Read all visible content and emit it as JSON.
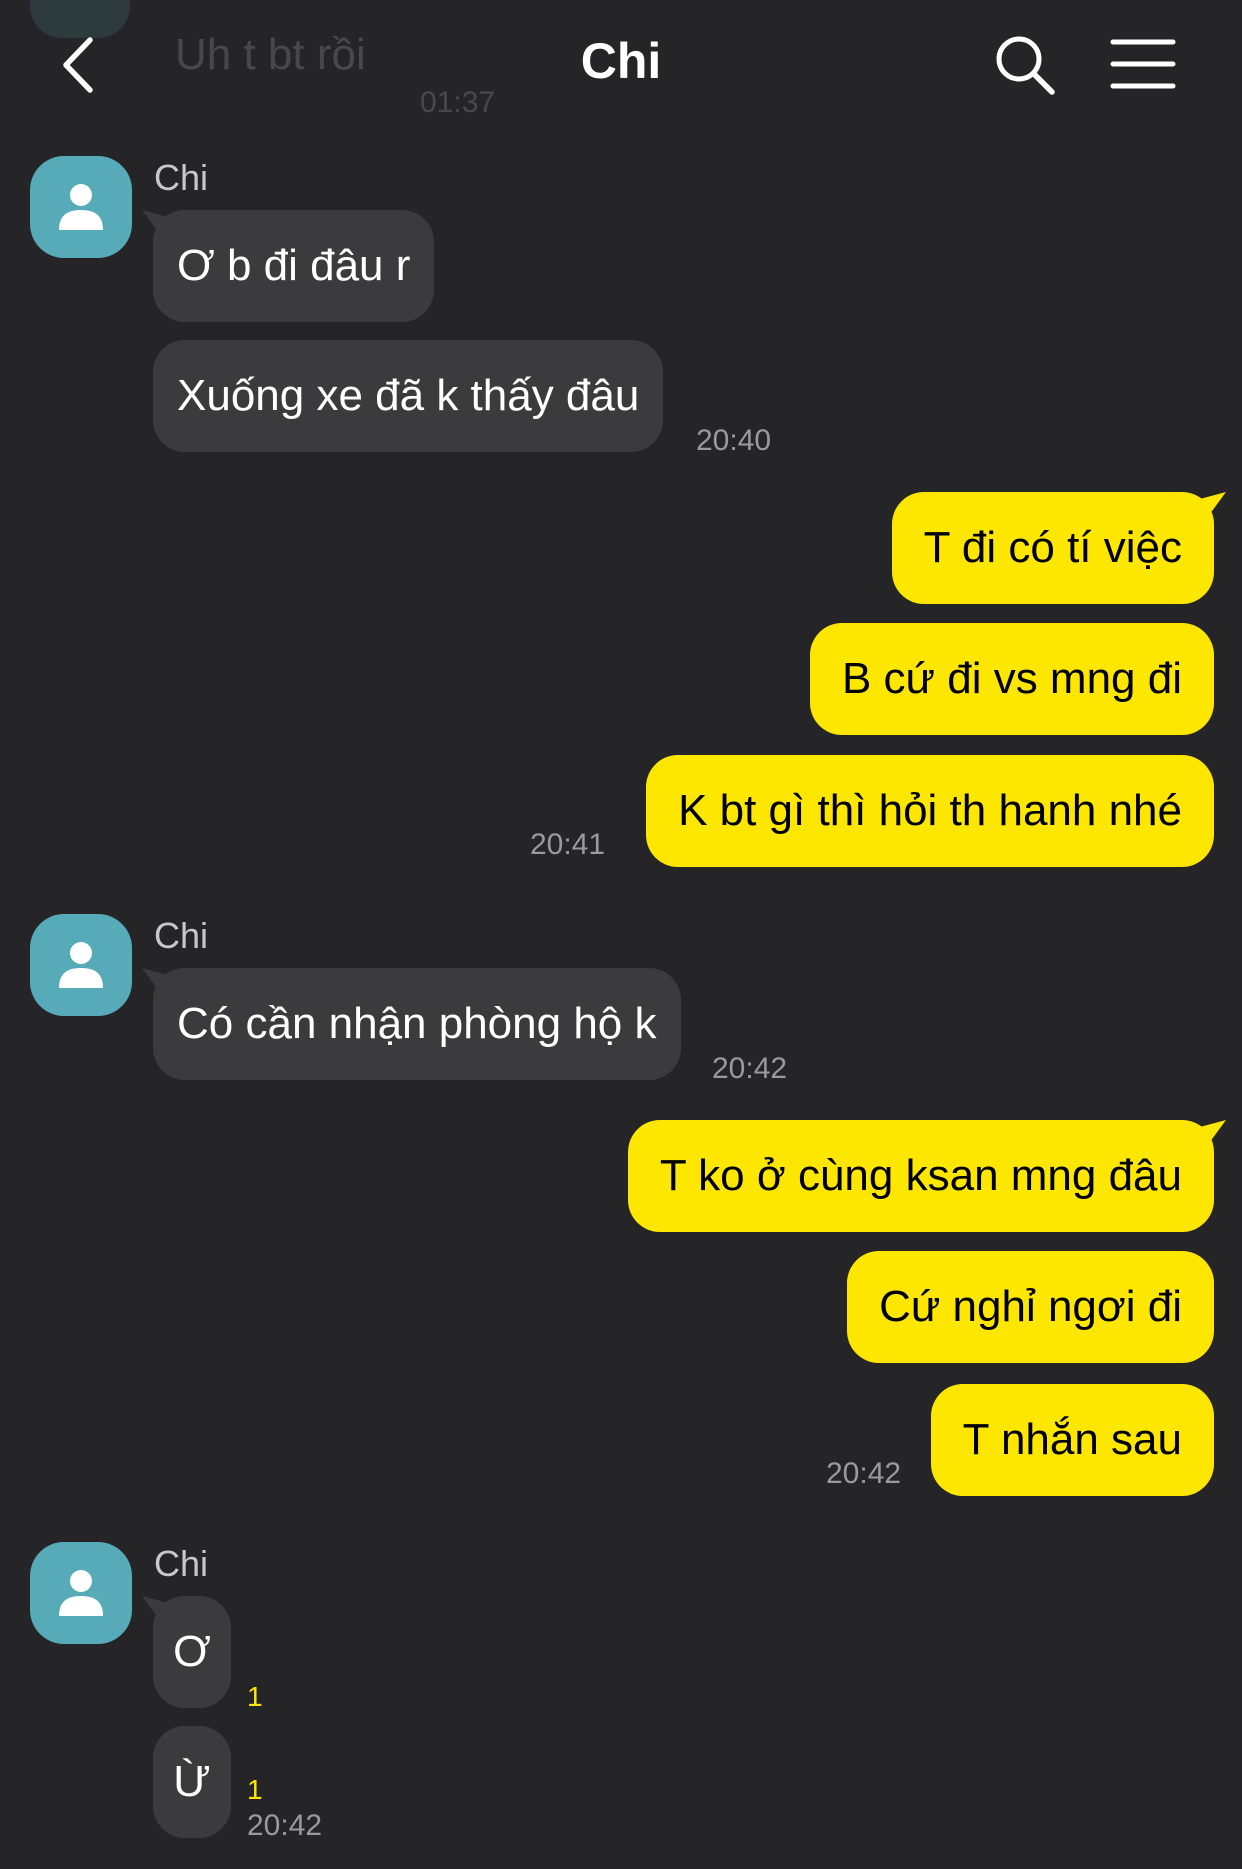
{
  "header": {
    "title": "Chi",
    "faded_previous_message": "Uh t bt rồi",
    "faded_previous_time": "01:37"
  },
  "messages": {
    "g1": {
      "sender": "Chi",
      "m1": "Ơ b đi đâu r",
      "m2": "Xuống xe đã k thấy đâu",
      "time": "20:40"
    },
    "g2": {
      "m1": "T đi có tí việc",
      "m2": "B cứ đi vs mng đi",
      "m3": "K bt gì thì hỏi th hanh nhé",
      "time": "20:41"
    },
    "g3": {
      "sender": "Chi",
      "m1": "Có cần nhận phòng hộ k",
      "time": "20:42"
    },
    "g4": {
      "m1": "T ko ở cùng ksan mng đâu",
      "m2": "Cứ nghỉ ngơi đi",
      "m3": "T nhắn sau",
      "time": "20:42"
    },
    "g5": {
      "sender": "Chi",
      "m1": "Ơ",
      "m1_unread": "1",
      "m2": "Ừ",
      "m2_unread": "1",
      "time": "20:42"
    }
  },
  "colors": {
    "background": "#252528",
    "incoming_bubble": "#3b3b3e",
    "outgoing_bubble": "#fde600",
    "avatar": "#57aab8",
    "unread_count": "#fde600"
  },
  "icons": {
    "back": "chevron-left-icon",
    "search": "search-icon",
    "menu": "hamburger-menu-icon",
    "avatar": "person-icon"
  }
}
